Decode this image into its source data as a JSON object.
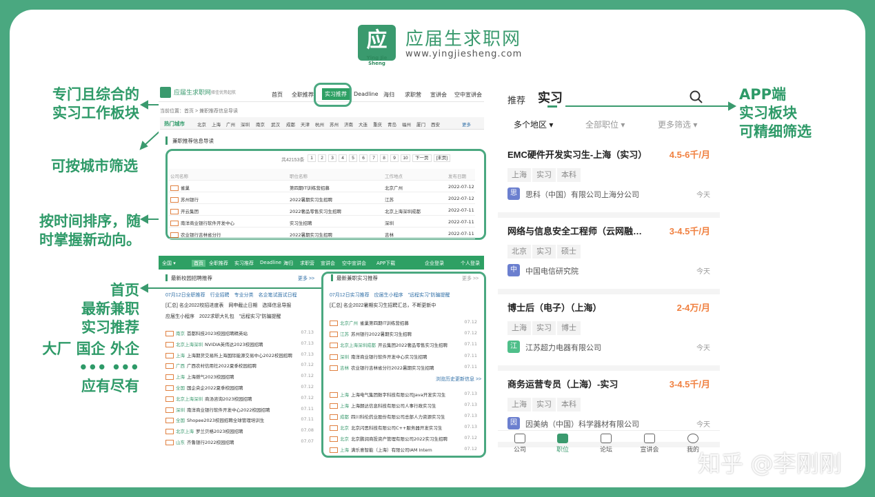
{
  "logo": {
    "mark": "应",
    "mark_sub": "Ying Jie Sheng",
    "name": "应届生求职网",
    "url": "www.yingjiesheng.com"
  },
  "callouts": {
    "c1": [
      "专门且综合的",
      "实习工作板块"
    ],
    "c2": "可按城市筛选",
    "c3": [
      "按时间排序，随",
      "时掌握新动向。"
    ],
    "c4": [
      "首页",
      "最新兼职",
      "实习推荐",
      "大厂 国企 外企",
      "••• •••",
      "应有尽有"
    ],
    "c5": [
      "APP端",
      "实习板块",
      "可精细筛选"
    ]
  },
  "desktop": {
    "brand": "应届生求职网",
    "slogan": "择佳优势起航",
    "nav": [
      "首页",
      "全职推荐",
      "实习推荐",
      "Deadline",
      "海归",
      "求职营",
      "宣讲会",
      "空中宣讲会"
    ],
    "breadcrumb": "当前位置：首页 > 兼职推荐信息导读",
    "hot_city_label": "热门城市",
    "cities": [
      "北京",
      "上海",
      "广州",
      "深圳",
      "南京",
      "武汉",
      "成都",
      "天津",
      "杭州",
      "苏州",
      "济南",
      "大连",
      "重庆",
      "青岛",
      "福州",
      "厦门",
      "西安"
    ],
    "more": "更多",
    "section": "兼职推荐信息导读",
    "pager": {
      "total": "共42153条",
      "pages": [
        "1",
        "2",
        "3",
        "4",
        "5",
        "6",
        "7",
        "8",
        "9",
        "10"
      ],
      "next": "下一页",
      "last": "[末页]"
    },
    "headers": [
      "公司名称",
      "职位名称",
      "工作地点",
      "发布日期"
    ],
    "rows": [
      {
        "company": "雀巢",
        "job": "第四期IT训练营招募",
        "place": "北京广州",
        "date": "2022-07-12"
      },
      {
        "company": "苏州银行",
        "job": "2022暑期实习生招聘",
        "place": "江苏",
        "date": "2022-07-12"
      },
      {
        "company": "开云集团",
        "job": "2022奢品零售实习生招聘",
        "place": "北京上海深圳成都",
        "date": "2022-07-11"
      },
      {
        "company": "南洋商业银行软件开发中心",
        "job": "实习生招聘",
        "place": "深圳",
        "date": "2022-07-11"
      },
      {
        "company": "农业银行吉林省分行",
        "job": "2022暑期实习生招聘",
        "place": "吉林",
        "date": "2022-07-11"
      }
    ],
    "greenbar": [
      "全国 ▾",
      "首页",
      "全职推荐",
      "实习推荐",
      "Deadline",
      "海归",
      "求职营",
      "宣讲会",
      "空中宣讲会",
      "APP下载",
      "企业登录",
      "个人登录"
    ],
    "left_section": "最新校园招聘推荐",
    "left_more": "更多 >>",
    "left_links": "07月12日全职推荐　行业招聘　专业分类　名企笔试面试日程",
    "left_note1": "[汇总] 名企2022校招进度表　网申截止日期　选择信息导报",
    "left_note2": "应届生小程序　2022求职大礼包　\"远程实习\"防骗提醒",
    "left_list": [
      {
        "city": "南京",
        "text": "首都科技2023校园招聘精英站",
        "date": "07.13"
      },
      {
        "city": "北京上海深圳",
        "text": "NVIDIA英伟达2023校园招聘",
        "date": "07.13"
      },
      {
        "city": "上海",
        "text": "上海期货交易所上海国际能源交易中心2022校园招聘",
        "date": "07.13"
      },
      {
        "city": "广西",
        "text": "广西农村信用社2022夏季校园招聘",
        "date": "07.12"
      },
      {
        "city": "上海",
        "text": "上海燃气2023校园招聘",
        "date": "07.12"
      },
      {
        "city": "全国",
        "text": "国企央企2022夏季校园招聘",
        "date": "07.12"
      },
      {
        "city": "北京上海深圳",
        "text": "商汤咨询2023校园招聘",
        "date": "07.12"
      },
      {
        "city": "深圳",
        "text": "南洋商业银行软件开发中心2022校园招聘",
        "date": "07.11"
      },
      {
        "city": "全国",
        "text": "Shopee2023校园招聘全球管理培训生",
        "date": "07.11"
      },
      {
        "city": "北京上海",
        "text": "罗兰贝格2023校园招聘",
        "date": "07.08"
      },
      {
        "city": "山东",
        "text": "齐鲁银行2022校园招聘",
        "date": "07.07"
      }
    ],
    "right_section": "最新兼职实习推荐",
    "right_more": "更多 >>",
    "right_links": "07月12日实习推荐　应届生小程序　\"远程实习\"防骗提醒",
    "right_note": "[汇总] 名企2022暑期实习生招聘汇总，不断更新中",
    "right_list": [
      {
        "city": "北京广州",
        "text": "雀巢第四期IT训练营招募",
        "date": "07.12"
      },
      {
        "city": "江苏",
        "text": "苏州银行2022暑期实习生招聘",
        "date": "07.12"
      },
      {
        "city": "北京上海深圳成都",
        "text": "开云集团2022奢品零售实习生招聘",
        "date": "07.11"
      },
      {
        "city": "深圳",
        "text": "南洋商业银行软件开发中心实习生招聘",
        "date": "07.11"
      },
      {
        "city": "吉林",
        "text": "农业银行吉林省分行2022暑期实习生招聘",
        "date": "07.11"
      }
    ],
    "right_more2": "浏览历史更新信息 >>",
    "right_list2": [
      {
        "city": "上海",
        "text": "上海电气集团数字科技有限公司Java开发实习生",
        "date": "07.13"
      },
      {
        "city": "上海",
        "text": "上海朗达信息科技有限公司人事行政实习生",
        "date": "07.13"
      },
      {
        "city": "成都",
        "text": "四川科伦药业股份有限公司总部人力资源实习生",
        "date": "07.13"
      },
      {
        "city": "北京",
        "text": "北京闪思科技有限公司C++服务器开发实习生",
        "date": "07.13"
      },
      {
        "city": "北京",
        "text": "北京鹏润商投资产管理有限公司2022实习生招聘",
        "date": "07.12"
      },
      {
        "city": "上海",
        "text": "满乐意智能（上海）有限公司IAM Intern",
        "date": "07.12"
      }
    ]
  },
  "app": {
    "tab": "推荐",
    "query": "实习",
    "filters": [
      "多个地区",
      "全部职位",
      "更多筛选"
    ],
    "jobs": [
      {
        "title": "EMC硬件开发实习生-上海（实习）",
        "salary": "4.5-6千/月",
        "tags": [
          "上海",
          "实习",
          "本科"
        ],
        "icon": "思",
        "icon_color": "#6b7fcf",
        "company": "思科（中国）有限公司上海分公司",
        "time": "今天"
      },
      {
        "title": "网络与信息安全工程师（云网融…",
        "salary": "3-4.5千/月",
        "tags": [
          "北京",
          "实习",
          "硕士"
        ],
        "icon": "中",
        "icon_color": "#6b7fcf",
        "company": "中国电信研究院",
        "time": "今天"
      },
      {
        "title": "博士后（电子）（上海）",
        "salary": "2-4万/月",
        "tags": [
          "上海",
          "实习",
          "博士"
        ],
        "icon": "江",
        "icon_color": "#4fbf8a",
        "company": "江苏超力电器有限公司",
        "time": "今天"
      },
      {
        "title": "商务运营专员（上海）-实习",
        "salary": "3-4.5千/月",
        "tags": [
          "上海",
          "实习",
          "本科"
        ],
        "icon": "因",
        "icon_color": "#6b7fcf",
        "company": "因美纳（中国）科学器材有限公司",
        "time": "今天"
      }
    ],
    "tabbar": [
      "公司",
      "职位",
      "论坛",
      "宣讲会",
      "我的"
    ]
  },
  "watermark": "知乎 @李刚刚",
  "colors": {
    "brand_green": "#3a9a6e",
    "salary_orange": "#f08040",
    "frame": "#4aa880"
  }
}
